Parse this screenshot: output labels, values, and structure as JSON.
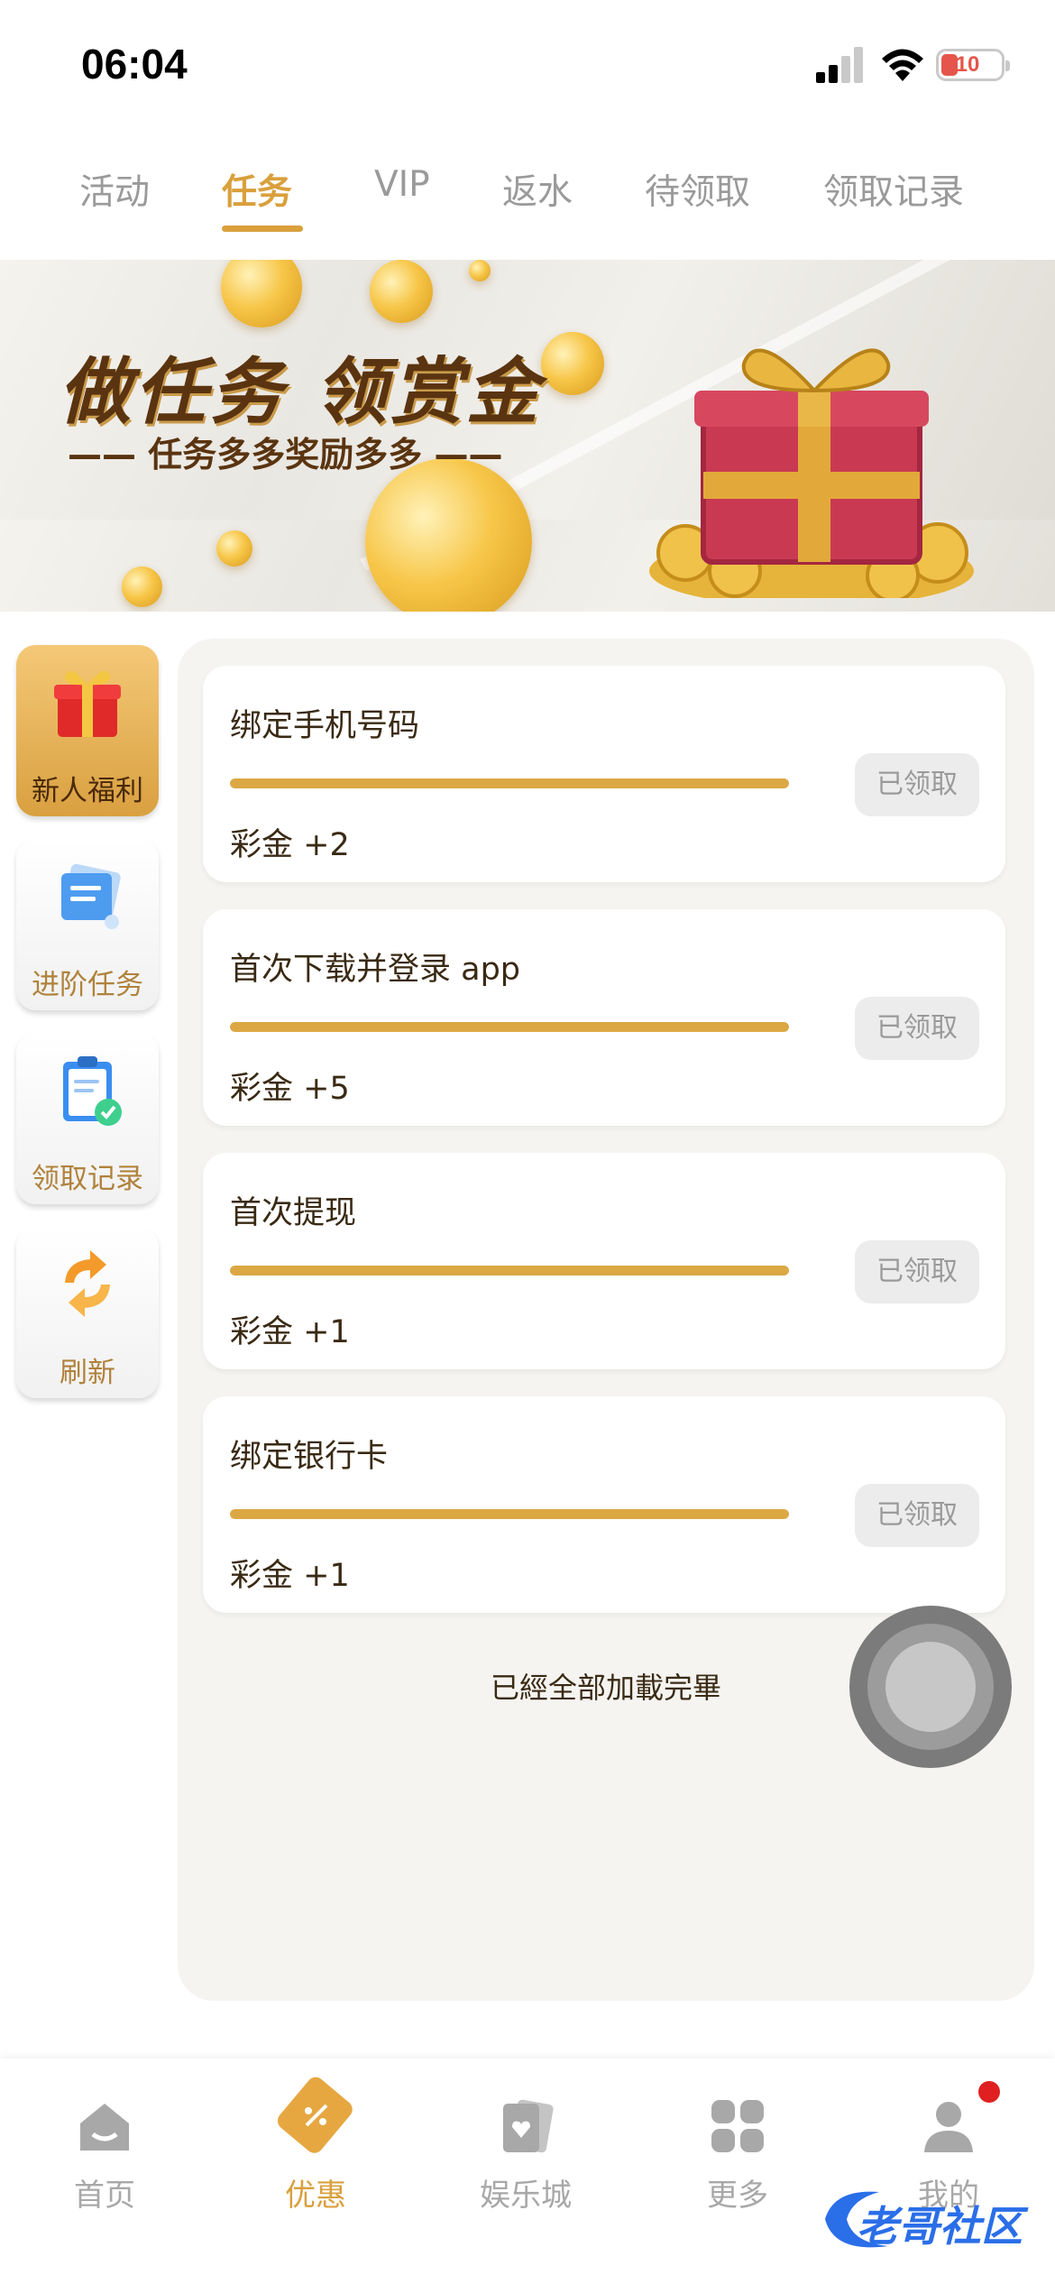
{
  "status_bar": {
    "time": "06:04",
    "battery": "10"
  },
  "tabs": [
    {
      "label": "活动"
    },
    {
      "label": "任务"
    },
    {
      "label": "VIP"
    },
    {
      "label": "返水"
    },
    {
      "label": "待领取"
    },
    {
      "label": "领取记录"
    }
  ],
  "active_tab": "任务",
  "banner": {
    "title": "做任务  领赏金",
    "subtitle": "—— 任务多多奖励多多 ——"
  },
  "sidebar": [
    {
      "label": "新人福利",
      "icon": "gift-box-icon"
    },
    {
      "label": "进阶任务",
      "icon": "document-stack-icon"
    },
    {
      "label": "领取记录",
      "icon": "clipboard-check-icon"
    },
    {
      "label": "刷新",
      "icon": "refresh-icon"
    }
  ],
  "tasks": [
    {
      "title": "绑定手机号码",
      "reward": "彩金 +2",
      "progress": 1.0,
      "button": "已领取"
    },
    {
      "title": "首次下载并登录 app",
      "reward": "彩金 +5",
      "progress": 1.0,
      "button": "已领取"
    },
    {
      "title": "首次提现",
      "reward": "彩金 +1",
      "progress": 1.0,
      "button": "已领取"
    },
    {
      "title": "绑定银行卡",
      "reward": "彩金 +1",
      "progress": 1.0,
      "button": "已领取"
    }
  ],
  "load_status": "已經全部加載完畢",
  "bottom_nav": [
    {
      "label": "首页",
      "icon": "home-icon"
    },
    {
      "label": "优惠",
      "icon": "ticket-icon"
    },
    {
      "label": "娱乐城",
      "icon": "cards-icon"
    },
    {
      "label": "更多",
      "icon": "grid-icon"
    },
    {
      "label": "我的",
      "icon": "user-icon"
    }
  ],
  "watermark": "老哥社区",
  "colors": {
    "accent": "#d9a03c",
    "progress": "#dba844",
    "badge": "#e02020"
  }
}
